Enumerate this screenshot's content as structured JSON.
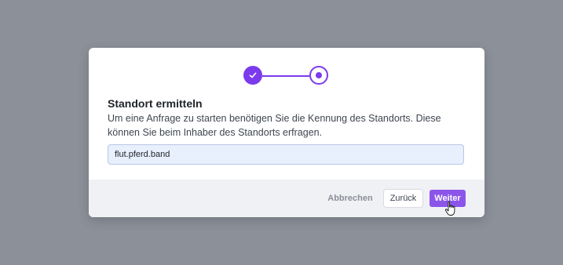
{
  "stepper": {
    "steps": [
      {
        "state": "completed",
        "icon": "check-icon"
      },
      {
        "state": "current",
        "icon": "dot-icon"
      }
    ],
    "accent_color": "#7c3aed"
  },
  "dialog": {
    "title": "Standort ermitteln",
    "description": "Um eine Anfrage zu starten benötigen Sie die Kennung des Standorts. Diese können Sie beim Inhaber des Standorts erfragen.",
    "input_value": "flut.pferd.band"
  },
  "footer": {
    "cancel_label": "Abbrechen",
    "back_label": "Zurück",
    "next_label": "Weiter"
  },
  "colors": {
    "backdrop": "#8c9099",
    "primary_button": "#8b55ea",
    "input_background": "#e8effd"
  },
  "cursor": {
    "icon": "hand-pointer-icon"
  }
}
